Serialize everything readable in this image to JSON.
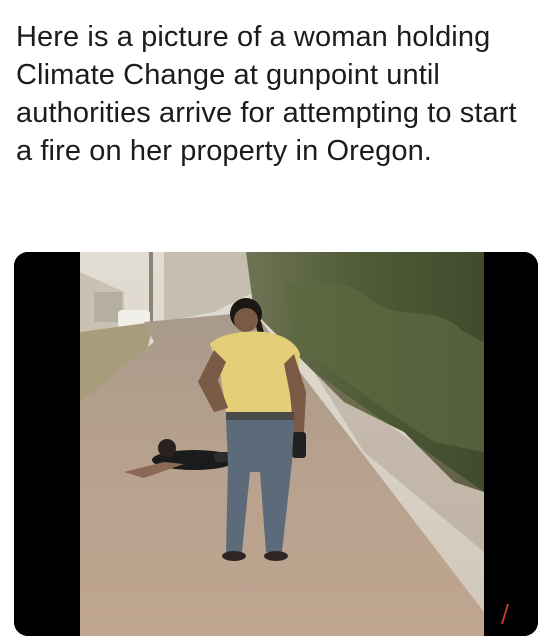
{
  "post": {
    "caption": "Here is a picture of a woman holding Climate Change at gunpoint until authorities arrive for attempting to start a fire on her property in Oregon."
  },
  "media": {
    "kind": "video-still",
    "colors": {
      "letterbox": "#000000",
      "smoke_sky": "#d8d2c8",
      "road": "#b49e8c",
      "foliage": "#4e5a36",
      "shirt": "#e8d27a",
      "jeans": "#5a6a7a"
    }
  }
}
